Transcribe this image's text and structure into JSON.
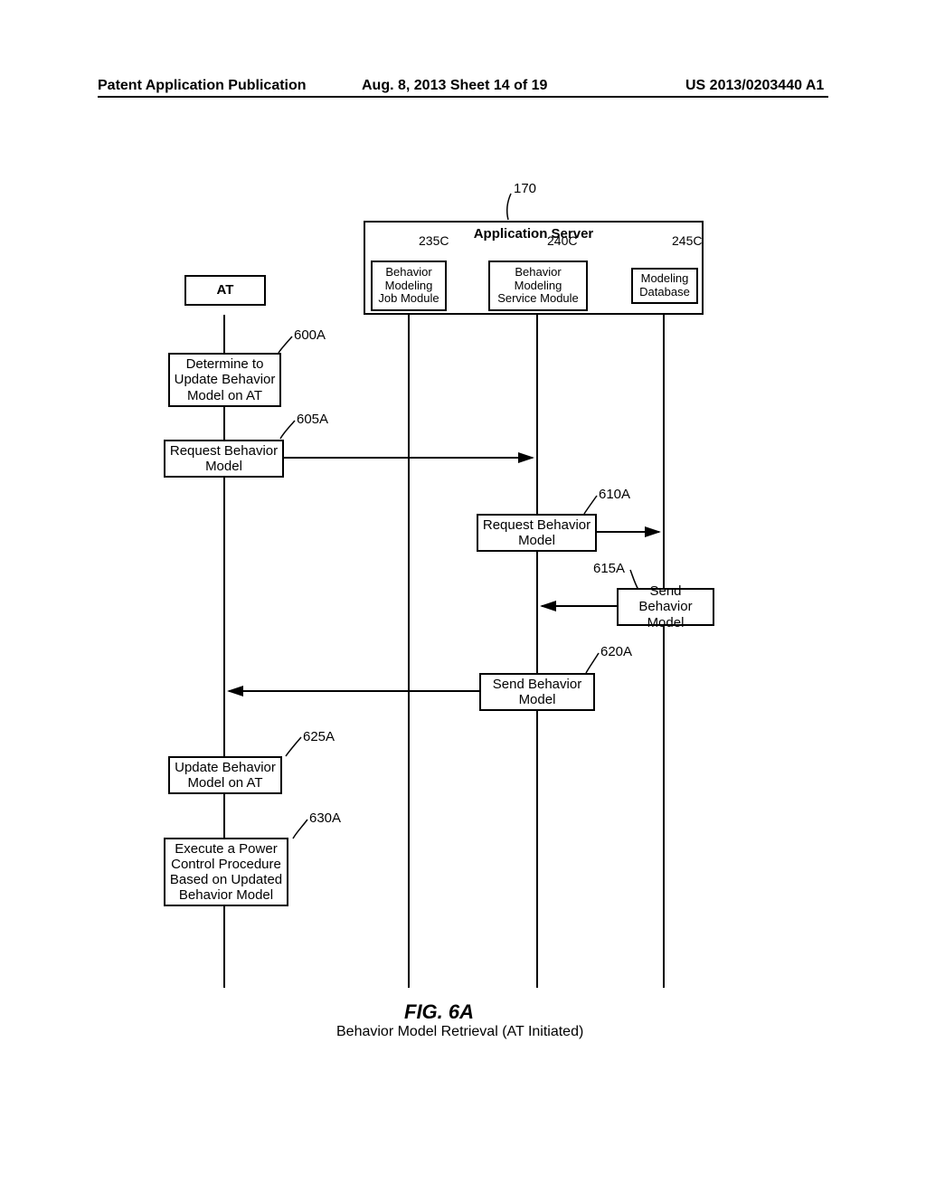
{
  "header": {
    "left": "Patent Application Publication",
    "center": "Aug. 8, 2013  Sheet 14 of 19",
    "right": "US 2013/0203440 A1"
  },
  "refs": {
    "r170": "170",
    "r235C": "235C",
    "r240C": "240C",
    "r245C": "245C",
    "r600A": "600A",
    "r605A": "605A",
    "r610A": "610A",
    "r615A": "615A",
    "r620A": "620A",
    "r625A": "625A",
    "r630A": "630A"
  },
  "boxes": {
    "appServer": "Application Server",
    "at": "AT",
    "jobModule_l1": "Behavior",
    "jobModule_l2": "Modeling",
    "jobModule_l3": "Job Module",
    "svcModule_l1": "Behavior",
    "svcModule_l2": "Modeling",
    "svcModule_l3": "Service Module",
    "db_l1": "Modeling",
    "db_l2": "Database",
    "b600_l1": "Determine to",
    "b600_l2": "Update Behavior",
    "b600_l3": "Model on AT",
    "b605_l1": "Request Behavior",
    "b605_l2": "Model",
    "b610_l1": "Request Behavior",
    "b610_l2": "Model",
    "b615_l1": "Send Behavior",
    "b615_l2": "Model",
    "b620_l1": "Send Behavior",
    "b620_l2": "Model",
    "b625_l1": "Update Behavior",
    "b625_l2": "Model on AT",
    "b630_l1": "Execute a Power",
    "b630_l2": "Control Procedure",
    "b630_l3": "Based on Updated",
    "b630_l4": "Behavior Model"
  },
  "figure": {
    "num": "FIG. 6A",
    "caption": "Behavior Model Retrieval (AT Initiated)"
  }
}
